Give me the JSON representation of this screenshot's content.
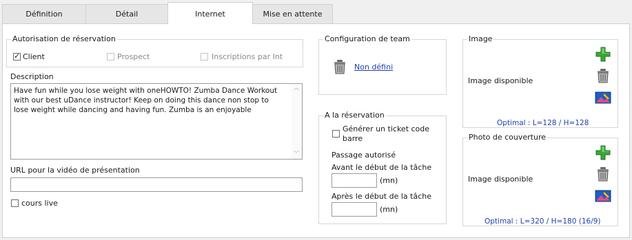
{
  "tabs": [
    {
      "label": "Définition"
    },
    {
      "label": "Détail"
    },
    {
      "label": "Internet"
    },
    {
      "label": "Mise en attente"
    }
  ],
  "reservation_auth": {
    "legend": "Autorisation de réservation",
    "client": {
      "label": "Client",
      "checked": true
    },
    "prospect": {
      "label": "Prospect",
      "checked": false
    },
    "inscriptions": {
      "label": "Inscriptions par Inte"
    }
  },
  "description": {
    "label": "Description",
    "value": "Have fun while you lose weight with oneHOWTO! Zumba Dance Workout with our best uDance instructor! Keep on doing this dance non stop to lose weight while dancing and having fun.  Zumba is an enjoyable"
  },
  "video_url": {
    "label": "URL pour la vidéo de présentation",
    "value": ""
  },
  "cours_live": {
    "label": "cours live",
    "checked": false
  },
  "team_config": {
    "legend": "Configuration de team",
    "link": "Non défini"
  },
  "reservation": {
    "legend": "A la réservation",
    "barcode_label": "Générer un ticket code barre",
    "passage_label": "Passage autorisé",
    "before_label": "Avant le début de la tâche",
    "before_value": "",
    "after_label": "Après le début de la tâche",
    "after_value": "",
    "unit": "(mn)"
  },
  "image": {
    "legend": "Image",
    "status": "Image disponible",
    "optimal": "Optimal : L=128 / H=128"
  },
  "cover": {
    "legend": "Photo de couverture",
    "status": "Image disponible",
    "optimal": "Optimal : L=320 / H=180 (16/9)"
  },
  "colors": {
    "link": "#1f3fb0",
    "add_icon": "#3aa836"
  }
}
